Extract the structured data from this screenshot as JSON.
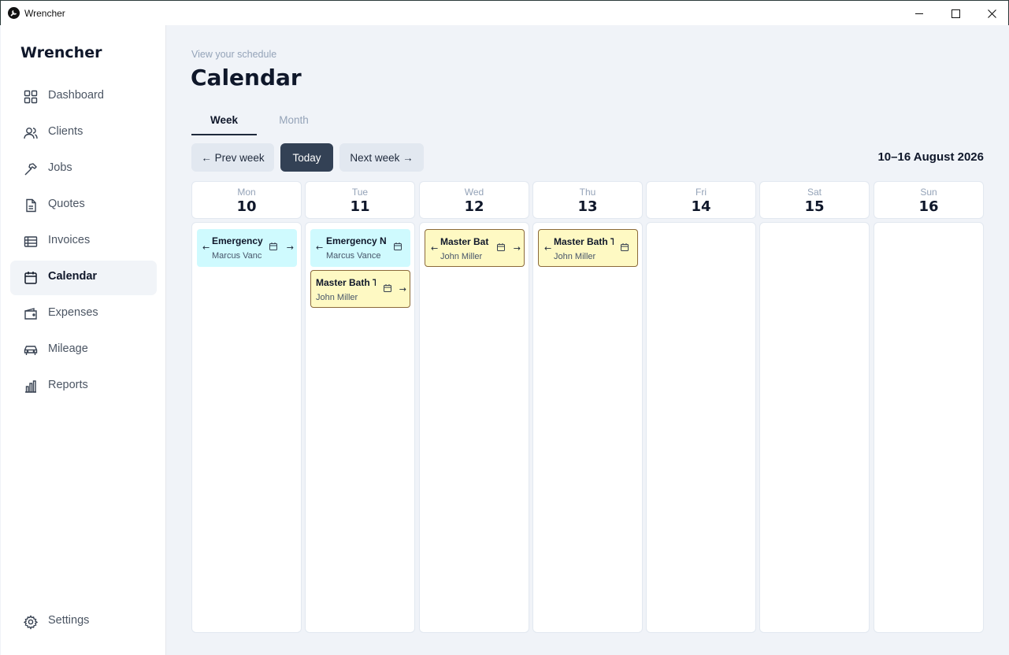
{
  "window": {
    "title": "Wrencher"
  },
  "sidebar": {
    "brand": "Wrencher",
    "items": [
      {
        "label": "Dashboard",
        "icon": "grid-icon",
        "active": false
      },
      {
        "label": "Clients",
        "icon": "users-icon",
        "active": false
      },
      {
        "label": "Jobs",
        "icon": "hammer-icon",
        "active": false
      },
      {
        "label": "Quotes",
        "icon": "document-icon",
        "active": false
      },
      {
        "label": "Invoices",
        "icon": "receipt-icon",
        "active": false
      },
      {
        "label": "Calendar",
        "icon": "calendar-icon",
        "active": true
      },
      {
        "label": "Expenses",
        "icon": "wallet-icon",
        "active": false
      },
      {
        "label": "Mileage",
        "icon": "car-icon",
        "active": false
      },
      {
        "label": "Reports",
        "icon": "bar-chart-icon",
        "active": false
      }
    ],
    "settings": {
      "label": "Settings",
      "icon": "gear-icon"
    }
  },
  "header": {
    "subtitle": "View your schedule",
    "title": "Calendar"
  },
  "tabs": [
    {
      "label": "Week",
      "active": true
    },
    {
      "label": "Month",
      "active": false
    }
  ],
  "toolbar": {
    "prev_label": "← Prev week",
    "today_label": "Today",
    "next_label": "Next week →",
    "range_label": "10–16 August 2026"
  },
  "days": [
    {
      "name": "Mon",
      "num": "10"
    },
    {
      "name": "Tue",
      "num": "11"
    },
    {
      "name": "Wed",
      "num": "12"
    },
    {
      "name": "Thu",
      "num": "13"
    },
    {
      "name": "Fri",
      "num": "14"
    },
    {
      "name": "Sat",
      "num": "15"
    },
    {
      "name": "Sun",
      "num": "16"
    }
  ],
  "events": {
    "mon": [
      {
        "title": "Emergency",
        "client": "Marcus Vance",
        "color": "cyan"
      }
    ],
    "tue": [
      {
        "title": "Emergency No",
        "client": "Marcus Vance",
        "color": "cyan"
      },
      {
        "title": "Master Bath T",
        "client": "John Miller",
        "color": "yellow"
      }
    ],
    "wed": [
      {
        "title": "Master Bat",
        "client": "John Miller",
        "color": "yellow"
      }
    ],
    "thu": [
      {
        "title": "Master Bath T",
        "client": "John Miller",
        "color": "yellow"
      }
    ]
  },
  "event_arrows": {
    "left": "←",
    "right": "→"
  },
  "colors": {
    "accent": "#334155",
    "event_cyan": "#cffafe",
    "event_yellow": "#fef9c3",
    "background": "#f0f3f8"
  }
}
